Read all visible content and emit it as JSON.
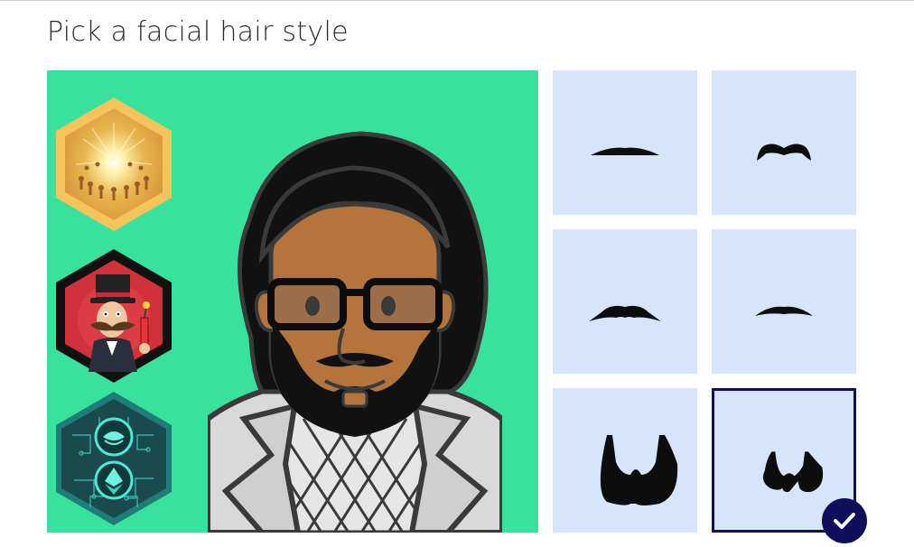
{
  "page": {
    "title": "Pick a facial hair style"
  },
  "colors": {
    "stage_background": "#38e29d",
    "option_background": "#d6e4fc",
    "selected_border": "#120f5a",
    "skin": "#b5743c",
    "hair": "#111111"
  },
  "badges": [
    {
      "icon": "sunburst-community-badge-icon"
    },
    {
      "icon": "magician-dynamite-badge-icon"
    },
    {
      "icon": "circuit-ethereum-badge-icon"
    }
  ],
  "avatar": {
    "icon": "avatar-preview-icon"
  },
  "styles": [
    {
      "icon": "thin-mustache-icon",
      "selected": false
    },
    {
      "icon": "handlebar-mustache-icon",
      "selected": false
    },
    {
      "icon": "chevron-mustache-icon",
      "selected": false
    },
    {
      "icon": "pencil-mustache-icon",
      "selected": false
    },
    {
      "icon": "full-beard-icon",
      "selected": false
    },
    {
      "icon": "chin-beard-icon",
      "selected": true
    }
  ],
  "selection": {
    "icon": "checkmark-icon"
  }
}
